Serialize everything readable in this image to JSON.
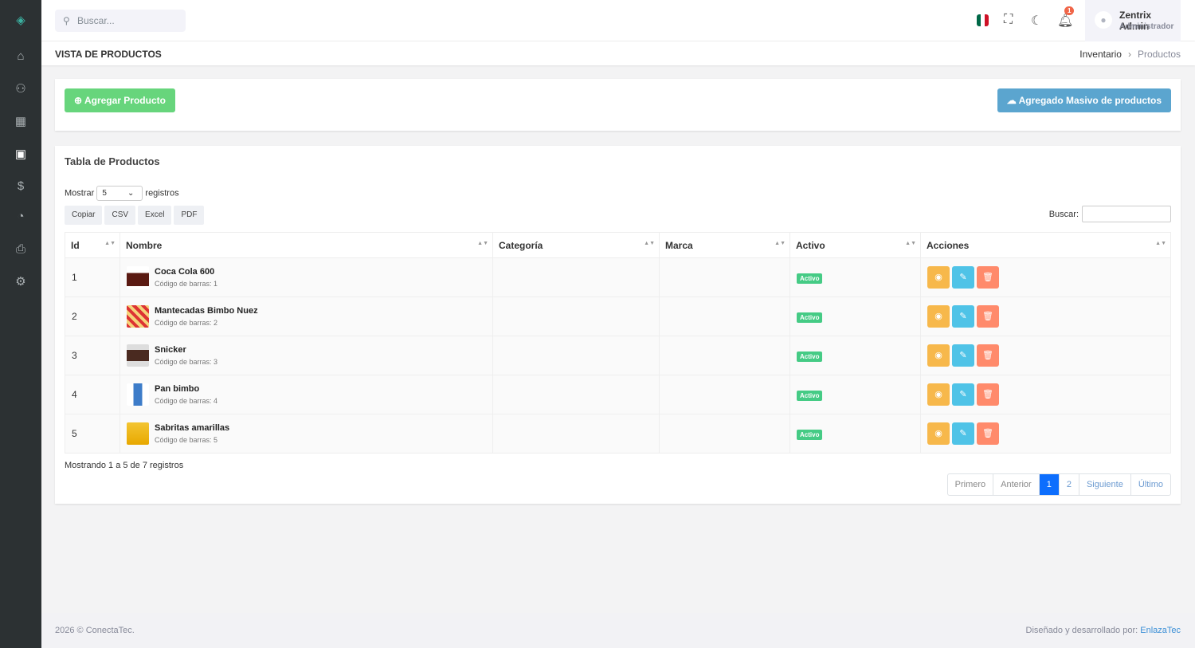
{
  "topbar": {
    "search_placeholder": "Buscar...",
    "notification_count": "1",
    "user_name": "Zentrix Admin",
    "user_role": "Administrador"
  },
  "page": {
    "title": "VISTA DE PRODUCTOS",
    "breadcrumb": [
      "Inventario",
      "Productos"
    ]
  },
  "actions": {
    "add": "Agregar Producto",
    "bulk": "Agregado Masivo de productos"
  },
  "table_card": {
    "title": "Tabla de Productos",
    "show_label": "Mostrar",
    "show_value": "5",
    "records_label": "registros",
    "export_buttons": [
      "Copiar",
      "CSV",
      "Excel",
      "PDF"
    ],
    "search_label": "Buscar:",
    "columns": [
      "Id",
      "Nombre",
      "Categoría",
      "Marca",
      "Activo",
      "Acciones"
    ],
    "rows": [
      {
        "id": "1",
        "name": "Coca Cola 600",
        "code": "Código de barras: 1",
        "category": "",
        "brand": "",
        "status": "Activo"
      },
      {
        "id": "2",
        "name": "Mantecadas Bimbo Nuez",
        "code": "Código de barras: 2",
        "category": "",
        "brand": "",
        "status": "Activo"
      },
      {
        "id": "3",
        "name": "Snicker",
        "code": "Código de barras: 3",
        "category": "",
        "brand": "",
        "status": "Activo"
      },
      {
        "id": "4",
        "name": "Pan bimbo",
        "code": "Código de barras: 4",
        "category": "",
        "brand": "",
        "status": "Activo"
      },
      {
        "id": "5",
        "name": "Sabritas amarillas",
        "code": "Código de barras: 5",
        "category": "",
        "brand": "",
        "status": "Activo"
      }
    ],
    "info": "Mostrando 1 a 5 de 7 registros",
    "pagination": [
      "Primero",
      "Anterior",
      "1",
      "2",
      "Siguiente",
      "Último"
    ],
    "current_page": "1"
  },
  "footer": {
    "left": "2026 © ConectaTec.",
    "right_prefix": "Diseñado y desarrollado por:",
    "right_link": "EnlazaTec"
  },
  "colors": {
    "green": "#67d57c",
    "blue": "#5ba5cf",
    "warning": "#f7b84b",
    "info": "#4fc3e7",
    "danger": "#ff8a6b"
  }
}
